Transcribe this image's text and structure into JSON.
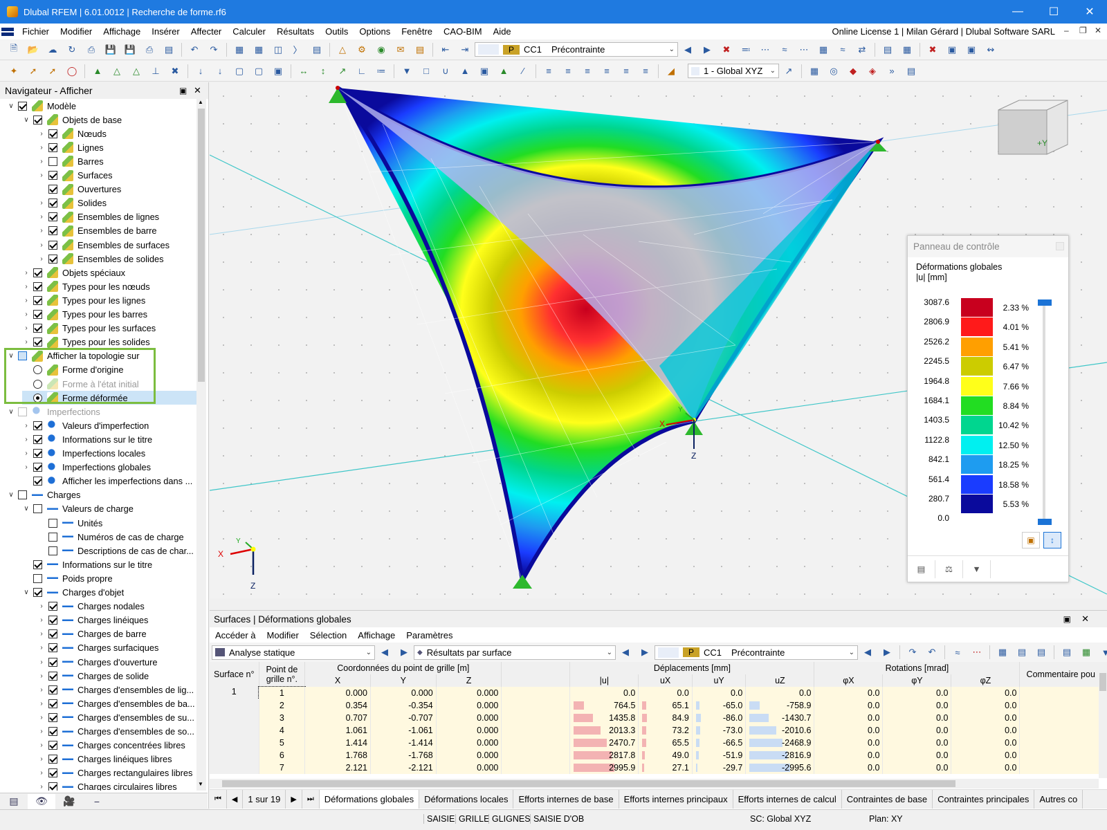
{
  "app": {
    "title": "Dlubal RFEM | 6.01.0012 | Recherche de forme.rf6"
  },
  "menu": {
    "items": [
      "Fichier",
      "Modifier",
      "Affichage",
      "Insérer",
      "Affecter",
      "Calculer",
      "Résultats",
      "Outils",
      "Options",
      "Fenêtre",
      "CAO-BIM",
      "Aide"
    ],
    "license": "Online License 1 | Milan Gérard | Dlubal Software SARL"
  },
  "toolbar": {
    "lc_badge": "P",
    "lc_id": "CC1",
    "lc_name": "Précontrainte",
    "view_combo": "1 - Global XYZ"
  },
  "navigator": {
    "title": "Navigateur - Afficher",
    "items": [
      {
        "label": "Modèle",
        "lvl": 0,
        "exp": "v",
        "cb": "on",
        "icon": "m"
      },
      {
        "label": "Objets de base",
        "lvl": 1,
        "exp": "v",
        "cb": "on",
        "icon": "m"
      },
      {
        "label": "Nœuds",
        "lvl": 2,
        "exp": ">",
        "cb": "on",
        "icon": "m"
      },
      {
        "label": "Lignes",
        "lvl": 2,
        "exp": ">",
        "cb": "on",
        "icon": "m"
      },
      {
        "label": "Barres",
        "lvl": 2,
        "exp": ">",
        "cb": "off",
        "icon": "m"
      },
      {
        "label": "Surfaces",
        "lvl": 2,
        "exp": ">",
        "cb": "on",
        "icon": "m"
      },
      {
        "label": "Ouvertures",
        "lvl": 2,
        "exp": "",
        "cb": "on",
        "icon": "m"
      },
      {
        "label": "Solides",
        "lvl": 2,
        "exp": ">",
        "cb": "on",
        "icon": "m"
      },
      {
        "label": "Ensembles de lignes",
        "lvl": 2,
        "exp": ">",
        "cb": "on",
        "icon": "m"
      },
      {
        "label": "Ensembles de barre",
        "lvl": 2,
        "exp": ">",
        "cb": "on",
        "icon": "m"
      },
      {
        "label": "Ensembles de surfaces",
        "lvl": 2,
        "exp": ">",
        "cb": "on",
        "icon": "m"
      },
      {
        "label": "Ensembles de solides",
        "lvl": 2,
        "exp": ">",
        "cb": "on",
        "icon": "m"
      },
      {
        "label": "Objets spéciaux",
        "lvl": 1,
        "exp": ">",
        "cb": "on",
        "icon": "m"
      },
      {
        "label": "Types pour les nœuds",
        "lvl": 1,
        "exp": ">",
        "cb": "on",
        "icon": "m"
      },
      {
        "label": "Types pour les lignes",
        "lvl": 1,
        "exp": ">",
        "cb": "on",
        "icon": "m"
      },
      {
        "label": "Types pour les barres",
        "lvl": 1,
        "exp": ">",
        "cb": "on",
        "icon": "m"
      },
      {
        "label": "Types pour les surfaces",
        "lvl": 1,
        "exp": ">",
        "cb": "on",
        "icon": "m"
      },
      {
        "label": "Types pour les solides",
        "lvl": 1,
        "exp": ">",
        "cb": "on",
        "icon": "m"
      },
      {
        "label": "Afficher la topologie sur",
        "lvl": 0,
        "exp": "v",
        "cb": "blue",
        "icon": "m"
      },
      {
        "label": "Forme d'origine",
        "lvl": 1,
        "exp": "",
        "cb": "radio",
        "icon": "m"
      },
      {
        "label": "Forme à l'état initial",
        "lvl": 1,
        "exp": "",
        "cb": "radio",
        "icon": "m",
        "dim": true
      },
      {
        "label": "Forme déformée",
        "lvl": 1,
        "exp": "",
        "cb": "radio-on",
        "icon": "m",
        "sel": true
      },
      {
        "label": "Imperfections",
        "lvl": 0,
        "exp": "v",
        "cb": "gray",
        "icon": "i",
        "dim": true
      },
      {
        "label": "Valeurs d'imperfection",
        "lvl": 1,
        "exp": ">",
        "cb": "on",
        "icon": "i"
      },
      {
        "label": "Informations sur le titre",
        "lvl": 1,
        "exp": ">",
        "cb": "on",
        "icon": "i"
      },
      {
        "label": "Imperfections locales",
        "lvl": 1,
        "exp": ">",
        "cb": "on",
        "icon": "i"
      },
      {
        "label": "Imperfections globales",
        "lvl": 1,
        "exp": ">",
        "cb": "on",
        "icon": "i"
      },
      {
        "label": "Afficher les imperfections dans ...",
        "lvl": 1,
        "exp": "",
        "cb": "on",
        "icon": "i"
      },
      {
        "label": "Charges",
        "lvl": 0,
        "exp": "v",
        "cb": "off",
        "icon": "l"
      },
      {
        "label": "Valeurs de charge",
        "lvl": 1,
        "exp": "v",
        "cb": "off",
        "icon": "l"
      },
      {
        "label": "Unités",
        "lvl": 2,
        "exp": "",
        "cb": "off",
        "icon": "l"
      },
      {
        "label": "Numéros de cas de charge",
        "lvl": 2,
        "exp": "",
        "cb": "off",
        "icon": "l"
      },
      {
        "label": "Descriptions de cas de char...",
        "lvl": 2,
        "exp": "",
        "cb": "off",
        "icon": "l"
      },
      {
        "label": "Informations sur le titre",
        "lvl": 1,
        "exp": "",
        "cb": "on",
        "icon": "l"
      },
      {
        "label": "Poids propre",
        "lvl": 1,
        "exp": "",
        "cb": "off",
        "icon": "l"
      },
      {
        "label": "Charges d'objet",
        "lvl": 1,
        "exp": "v",
        "cb": "on",
        "icon": "l"
      },
      {
        "label": "Charges nodales",
        "lvl": 2,
        "exp": ">",
        "cb": "on",
        "icon": "l"
      },
      {
        "label": "Charges linéiques",
        "lvl": 2,
        "exp": ">",
        "cb": "on",
        "icon": "l"
      },
      {
        "label": "Charges de barre",
        "lvl": 2,
        "exp": ">",
        "cb": "on",
        "icon": "l"
      },
      {
        "label": "Charges surfaciques",
        "lvl": 2,
        "exp": ">",
        "cb": "on",
        "icon": "l"
      },
      {
        "label": "Charges d'ouverture",
        "lvl": 2,
        "exp": ">",
        "cb": "on",
        "icon": "l"
      },
      {
        "label": "Charges de solide",
        "lvl": 2,
        "exp": ">",
        "cb": "on",
        "icon": "l"
      },
      {
        "label": "Charges d'ensembles de lig...",
        "lvl": 2,
        "exp": ">",
        "cb": "on",
        "icon": "l"
      },
      {
        "label": "Charges d'ensembles de ba...",
        "lvl": 2,
        "exp": ">",
        "cb": "on",
        "icon": "l"
      },
      {
        "label": "Charges d'ensembles de su...",
        "lvl": 2,
        "exp": ">",
        "cb": "on",
        "icon": "l"
      },
      {
        "label": "Charges d'ensembles de so...",
        "lvl": 2,
        "exp": ">",
        "cb": "on",
        "icon": "l"
      },
      {
        "label": "Charges concentrées libres",
        "lvl": 2,
        "exp": ">",
        "cb": "on",
        "icon": "l"
      },
      {
        "label": "Charges linéiques libres",
        "lvl": 2,
        "exp": ">",
        "cb": "on",
        "icon": "l"
      },
      {
        "label": "Charges rectangulaires libres",
        "lvl": 2,
        "exp": ">",
        "cb": "on",
        "icon": "l"
      },
      {
        "label": "Charges circulaires libres",
        "lvl": 2,
        "exp": ">",
        "cb": "on",
        "icon": "l"
      }
    ]
  },
  "viewport": {
    "cube_label": "+Y",
    "axis_x": "X",
    "axis_y": "Y",
    "axis_z": "Z"
  },
  "control_panel": {
    "title": "Panneau de contrôle",
    "heading": "Déformations globales",
    "unit": "|u| [mm]",
    "values": [
      "3087.6",
      "2806.9",
      "2526.2",
      "2245.5",
      "1964.8",
      "1684.1",
      "1403.5",
      "1122.8",
      "842.1",
      "561.4",
      "280.7",
      "0.0"
    ],
    "percents": [
      "2.33 %",
      "4.01 %",
      "5.41 %",
      "6.47 %",
      "7.66 %",
      "8.84 %",
      "10.42 %",
      "12.50 %",
      "18.25 %",
      "18.58 %",
      "5.53 %"
    ],
    "colors": [
      "#c8001e",
      "#ff1a1a",
      "#ff9f00",
      "#cccc00",
      "#ffff1a",
      "#22dd22",
      "#00d68f",
      "#00f0f0",
      "#1e9cf0",
      "#1a3cff",
      "#0a0a9c"
    ]
  },
  "results": {
    "title": "Surfaces | Déformations globales",
    "menu": [
      "Accéder à",
      "Modifier",
      "Sélection",
      "Affichage",
      "Paramètres"
    ],
    "analysis": "Analyse statique",
    "result_type": "Résultats par surface",
    "lc_badge": "P",
    "lc_id": "CC1",
    "lc_name": "Précontrainte",
    "headers": {
      "surface": "Surface n°",
      "point": "Point de grille n°.",
      "coords": "Coordonnées du point de grille [m]",
      "x": "X",
      "y": "Y",
      "z": "Z",
      "disp": "Déplacements [mm]",
      "u": "|u|",
      "ux": "uX",
      "uy": "uY",
      "uz": "uZ",
      "rot": "Rotations [mrad]",
      "px": "φX",
      "py": "φY",
      "pz": "φZ",
      "comment": "Commentaire pou"
    },
    "rows": [
      {
        "s": "1",
        "p": "1",
        "x": "0.000",
        "y": "0.000",
        "z": "0.000",
        "u": "0.0",
        "ux": "0.0",
        "uy": "0.0",
        "uz": "0.0",
        "px": "0.0",
        "py": "0.0",
        "pz": "0.0"
      },
      {
        "s": "",
        "p": "2",
        "x": "0.354",
        "y": "-0.354",
        "z": "0.000",
        "u": "764.5",
        "ux": "65.1",
        "uy": "-65.0",
        "uz": "-758.9",
        "px": "0.0",
        "py": "0.0",
        "pz": "0.0"
      },
      {
        "s": "",
        "p": "3",
        "x": "0.707",
        "y": "-0.707",
        "z": "0.000",
        "u": "1435.8",
        "ux": "84.9",
        "uy": "-86.0",
        "uz": "-1430.7",
        "px": "0.0",
        "py": "0.0",
        "pz": "0.0"
      },
      {
        "s": "",
        "p": "4",
        "x": "1.061",
        "y": "-1.061",
        "z": "0.000",
        "u": "2013.3",
        "ux": "73.2",
        "uy": "-73.0",
        "uz": "-2010.6",
        "px": "0.0",
        "py": "0.0",
        "pz": "0.0"
      },
      {
        "s": "",
        "p": "5",
        "x": "1.414",
        "y": "-1.414",
        "z": "0.000",
        "u": "2470.7",
        "ux": "65.5",
        "uy": "-66.5",
        "uz": "-2468.9",
        "px": "0.0",
        "py": "0.0",
        "pz": "0.0"
      },
      {
        "s": "",
        "p": "6",
        "x": "1.768",
        "y": "-1.768",
        "z": "0.000",
        "u": "2817.8",
        "ux": "49.0",
        "uy": "-51.9",
        "uz": "-2816.9",
        "px": "0.0",
        "py": "0.0",
        "pz": "0.0"
      },
      {
        "s": "",
        "p": "7",
        "x": "2.121",
        "y": "-2.121",
        "z": "0.000",
        "u": "2995.9",
        "ux": "27.1",
        "uy": "-29.7",
        "uz": "-2995.6",
        "px": "0.0",
        "py": "0.0",
        "pz": "0.0"
      }
    ],
    "pager": "1 sur 19",
    "tabs": [
      "Déformations globales",
      "Déformations locales",
      "Efforts internes de base",
      "Efforts internes principaux",
      "Efforts internes de calcul",
      "Contraintes de base",
      "Contraintes principales",
      "Autres co"
    ]
  },
  "status": {
    "items": [
      "SAISIE",
      "GRILLE",
      "GLIGNES",
      "SAISIE D'OB"
    ],
    "cs": "SC: Global XYZ",
    "plan": "Plan: XY"
  }
}
